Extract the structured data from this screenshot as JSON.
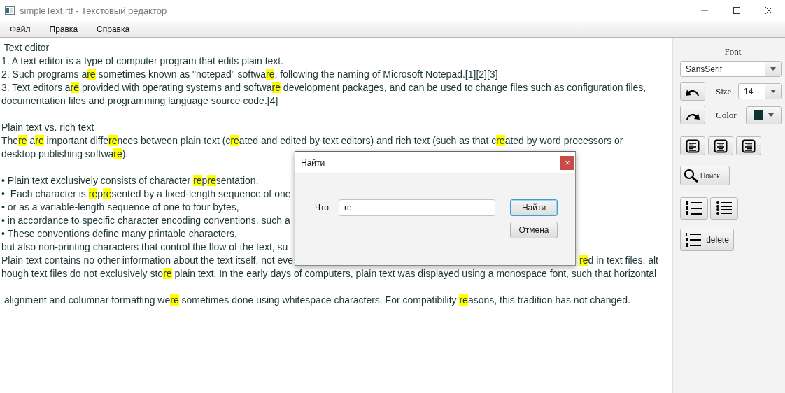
{
  "window": {
    "title": "simpleText.rtf - Текстовый редактор"
  },
  "menu": [
    "Файл",
    "Правка",
    "Справка"
  ],
  "document": {
    "lines": [
      {
        "kind": "text",
        "segments": [
          {
            "text": " Text editor",
            "highlight": false
          }
        ]
      },
      {
        "kind": "text",
        "segments": [
          {
            "text": "1. A text editor is a type of computer program that edits plain text.",
            "highlight": false
          }
        ]
      },
      {
        "kind": "text",
        "segments": [
          {
            "text": "2. Such programs a",
            "highlight": false
          },
          {
            "text": "re",
            "highlight": true
          },
          {
            "text": " sometimes known as \"notepad\" softwa",
            "highlight": false
          },
          {
            "text": "re",
            "highlight": true
          },
          {
            "text": ", following the naming of Microsoft Notepad.[1][2][3]",
            "highlight": false
          }
        ]
      },
      {
        "kind": "text",
        "segments": [
          {
            "text": "3. Text editors a",
            "highlight": false
          },
          {
            "text": "re",
            "highlight": true
          },
          {
            "text": " provided with operating systems and softwa",
            "highlight": false
          },
          {
            "text": "re",
            "highlight": true
          },
          {
            "text": " development packages, and can be used to change files such as configuration files,",
            "highlight": false
          }
        ]
      },
      {
        "kind": "text",
        "segments": [
          {
            "text": "documentation files and programming language source code.[4]",
            "highlight": false
          }
        ]
      },
      {
        "kind": "blank"
      },
      {
        "kind": "text",
        "segments": [
          {
            "text": "Plain text vs. rich text",
            "highlight": false
          }
        ]
      },
      {
        "kind": "text",
        "segments": [
          {
            "text": "The",
            "highlight": false
          },
          {
            "text": "re",
            "highlight": true
          },
          {
            "text": " a",
            "highlight": false
          },
          {
            "text": "re",
            "highlight": true
          },
          {
            "text": " important diffe",
            "highlight": false
          },
          {
            "text": "re",
            "highlight": true
          },
          {
            "text": "nces between plain text (c",
            "highlight": false
          },
          {
            "text": "re",
            "highlight": true
          },
          {
            "text": "ated and edited by text editors) and rich text (such as that c",
            "highlight": false
          },
          {
            "text": "re",
            "highlight": true
          },
          {
            "text": "ated by word processors or",
            "highlight": false
          }
        ]
      },
      {
        "kind": "text",
        "segments": [
          {
            "text": "desktop publishing softwa",
            "highlight": false
          },
          {
            "text": "re",
            "highlight": true
          },
          {
            "text": ").",
            "highlight": false
          }
        ]
      },
      {
        "kind": "blank"
      },
      {
        "kind": "text",
        "segments": [
          {
            "text": "• Plain text exclusively consists of character ",
            "highlight": false
          },
          {
            "text": "re",
            "highlight": true
          },
          {
            "text": "p",
            "highlight": false
          },
          {
            "text": "re",
            "highlight": true
          },
          {
            "text": "sentation.",
            "highlight": false
          }
        ]
      },
      {
        "kind": "text",
        "segments": [
          {
            "text": "•  Each character is ",
            "highlight": false
          },
          {
            "text": "re",
            "highlight": true
          },
          {
            "text": "p",
            "highlight": false
          },
          {
            "text": "re",
            "highlight": true
          },
          {
            "text": "sented by a fixed-length sequence of one",
            "highlight": false
          }
        ]
      },
      {
        "kind": "text",
        "segments": [
          {
            "text": "• or as a variable-length sequence of one to four bytes,",
            "highlight": false
          }
        ]
      },
      {
        "kind": "text",
        "segments": [
          {
            "text": "• in accordance to specific character encoding conventions, such a",
            "highlight": false
          }
        ]
      },
      {
        "kind": "text",
        "segments": [
          {
            "text": "• These conventions define many printable characters,",
            "highlight": false
          }
        ]
      },
      {
        "kind": "text",
        "segments": [
          {
            "text": "but also non-printing characters that control the flow of the text, su",
            "highlight": false
          }
        ]
      },
      {
        "kind": "text",
        "segments": [
          {
            "text": "Plain text contains no other information about the text itself, not eve",
            "highlight": false
          }
        ],
        "tail": [
          {
            "text": "re",
            "highlight": true
          },
          {
            "text": "d in text files, alt",
            "highlight": false
          }
        ]
      },
      {
        "kind": "text",
        "segments": [
          {
            "text": "hough text files do not exclusively sto",
            "highlight": false
          },
          {
            "text": "re",
            "highlight": true
          },
          {
            "text": " plain text. In the early days of computers, plain text was displayed using a monospace font, such that horizontal",
            "highlight": false
          }
        ]
      },
      {
        "kind": "blank"
      },
      {
        "kind": "text",
        "segments": [
          {
            "text": " alignment and columnar formatting we",
            "highlight": false
          },
          {
            "text": "re",
            "highlight": true
          },
          {
            "text": " sometimes done using whitespace characters. For compatibility ",
            "highlight": false
          },
          {
            "text": "re",
            "highlight": true
          },
          {
            "text": "asons, this tradition has not changed.",
            "highlight": false
          }
        ]
      }
    ]
  },
  "sidebar": {
    "font_label": "Font",
    "font_value": "SansSerif",
    "size_label": "Size",
    "size_value": "14",
    "color_label": "Color",
    "color": "#0d3333",
    "search_button": "Поиск",
    "delete_button": "delete"
  },
  "dialog": {
    "title": "Найти",
    "close": "×",
    "field_label": "Что:",
    "field_value": "re",
    "buttons": [
      {
        "label": "Найти",
        "default": true
      },
      {
        "label": "Отмена",
        "default": false
      }
    ]
  }
}
